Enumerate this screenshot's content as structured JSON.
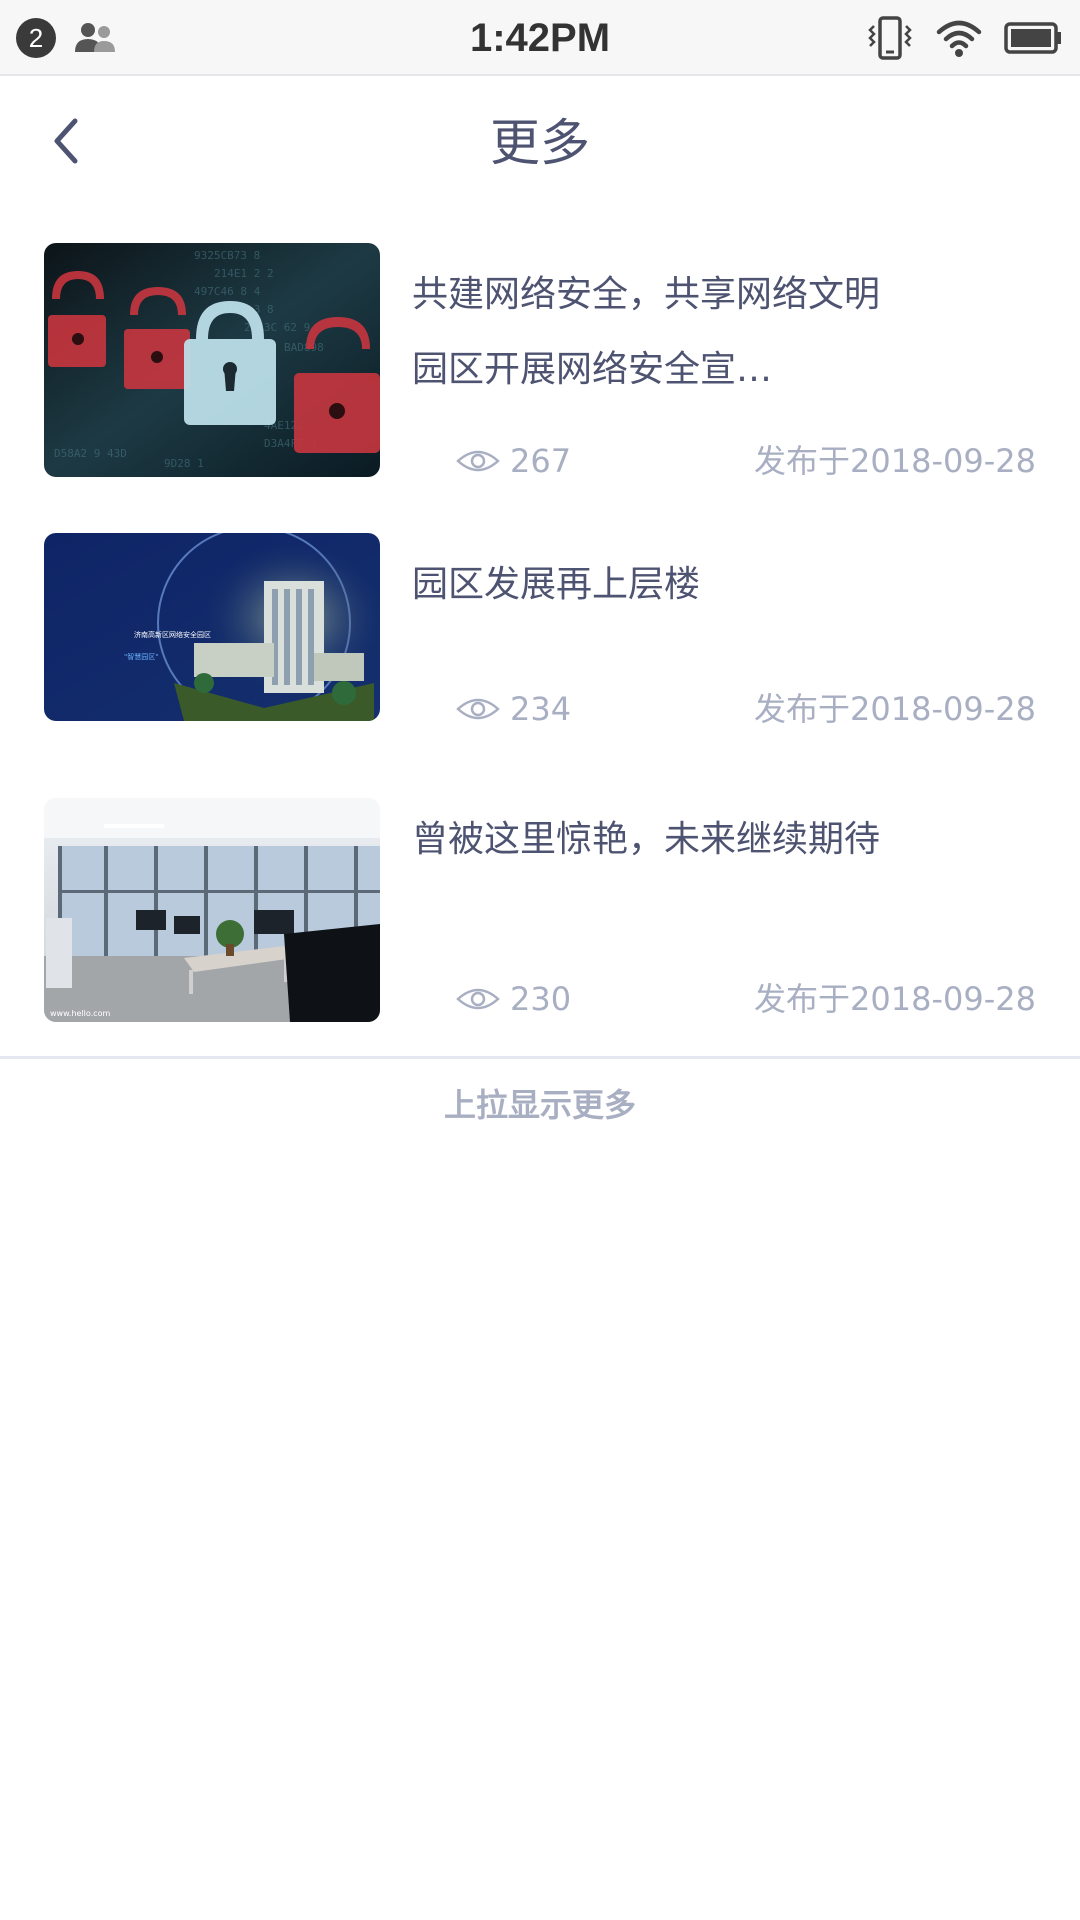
{
  "status_bar": {
    "notification_count": "2",
    "time": "1:42PM",
    "icons": [
      "contacts-icon",
      "vibrate-icon",
      "wifi-icon",
      "battery-icon"
    ]
  },
  "header": {
    "title": "更多",
    "back_icon": "chevron-left-icon"
  },
  "news": [
    {
      "title": "共建网络安全，共享网络文明 园区开展网络安全宣…",
      "views": "267",
      "date": "发布于2018-09-28",
      "thumbnail": "padlock-cyber-security-image"
    },
    {
      "title": "园区发展再上层楼",
      "views": "234",
      "date": "发布于2018-09-28",
      "thumbnail": "park-building-aerial-image"
    },
    {
      "title": "曾被这里惊艳，未来继续期待",
      "views": "230",
      "date": "发布于2018-09-28",
      "thumbnail": "office-interior-image"
    }
  ],
  "footer": {
    "load_more": "上拉显示更多"
  },
  "colors": {
    "text_primary": "#4d5370",
    "text_secondary": "#a9afc2",
    "divider": "#e6e7f0"
  }
}
